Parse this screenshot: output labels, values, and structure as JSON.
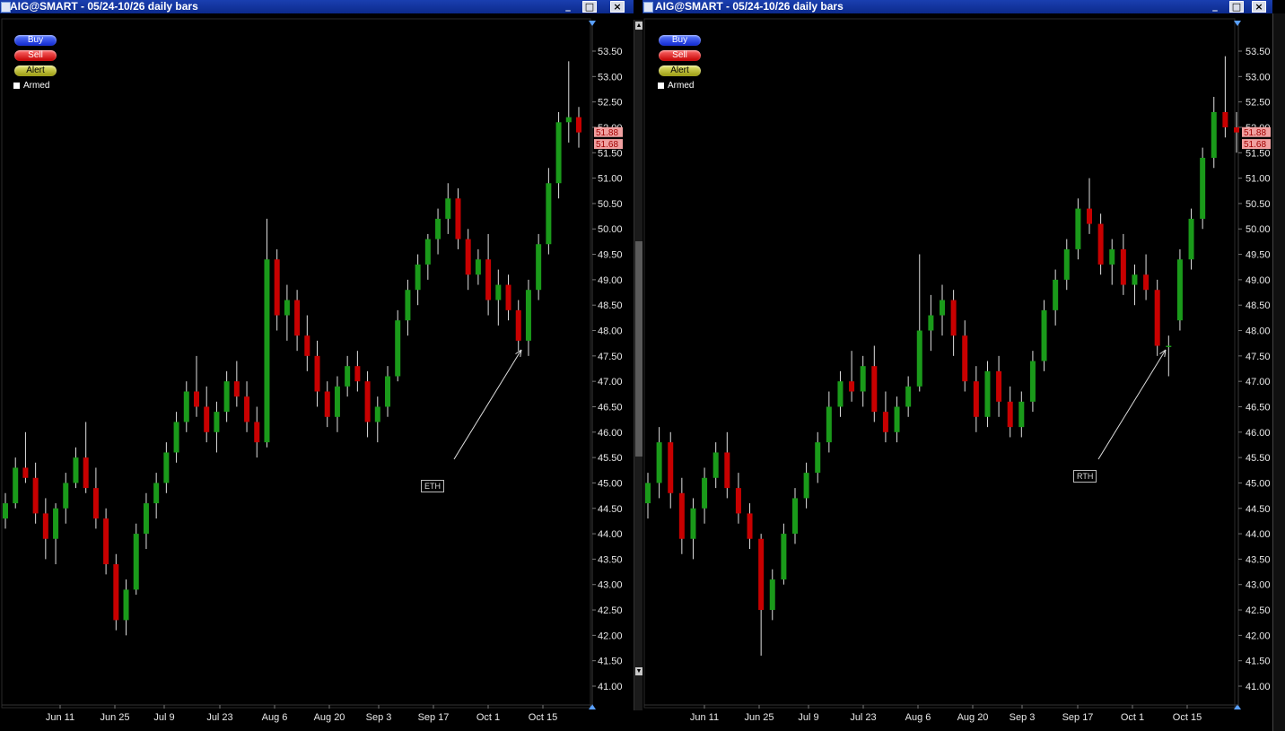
{
  "app": {
    "colors": {
      "bg": "#000000",
      "up": "#1a9a1a",
      "down": "#c80000",
      "wick": "#e0e0e0",
      "title_bar": "#1a3fb0"
    }
  },
  "windows": [
    {
      "title": "AIG@SMART - 05/24-10/26 daily bars",
      "buttons": {
        "buy": "Buy",
        "sell": "Sell",
        "alert": "Alert",
        "armed": "Armed"
      },
      "annotation": "ETH",
      "last_prices": [
        "51.88",
        "51.68"
      ]
    },
    {
      "title": "AIG@SMART - 05/24-10/26 daily bars",
      "buttons": {
        "buy": "Buy",
        "sell": "Sell",
        "alert": "Alert",
        "armed": "Armed"
      },
      "annotation": "RTH",
      "last_prices": [
        "51.88",
        "51.68"
      ]
    }
  ],
  "window_controls": {
    "minimize": "_",
    "maximize": "□",
    "close": "×"
  },
  "chart_data": [
    {
      "type": "candlestick",
      "title": "AIG@SMART - 05/24-10/26 daily bars",
      "session": "ETH",
      "ylim": [
        41.0,
        53.5
      ],
      "yticks": [
        "53.50",
        "53.00",
        "52.50",
        "52.00",
        "51.50",
        "51.00",
        "50.50",
        "50.00",
        "49.50",
        "49.00",
        "48.50",
        "48.00",
        "47.50",
        "47.00",
        "46.50",
        "46.00",
        "45.50",
        "45.00",
        "44.50",
        "44.00",
        "43.50",
        "43.00",
        "42.50",
        "42.00",
        "41.50",
        "41.00"
      ],
      "xticks": [
        "Jun 11",
        "Jun 25",
        "Jul 9",
        "Jul 23",
        "Aug 6",
        "Aug 20",
        "Sep 3",
        "Sep 17",
        "Oct 1",
        "Oct 15"
      ],
      "last": [
        51.88,
        51.68
      ],
      "candles": [
        [
          44.3,
          44.8,
          44.1,
          44.6
        ],
        [
          44.6,
          45.5,
          44.5,
          45.3
        ],
        [
          45.3,
          46.0,
          45.0,
          45.1
        ],
        [
          45.1,
          45.4,
          44.2,
          44.4
        ],
        [
          44.4,
          44.7,
          43.5,
          43.9
        ],
        [
          43.9,
          44.6,
          43.4,
          44.5
        ],
        [
          44.5,
          45.2,
          44.2,
          45.0
        ],
        [
          45.0,
          45.7,
          44.9,
          45.5
        ],
        [
          45.5,
          46.2,
          44.8,
          44.9
        ],
        [
          44.9,
          45.3,
          44.1,
          44.3
        ],
        [
          44.3,
          44.5,
          43.2,
          43.4
        ],
        [
          43.4,
          43.6,
          42.1,
          42.3
        ],
        [
          42.3,
          43.1,
          42.0,
          42.9
        ],
        [
          42.9,
          44.2,
          42.8,
          44.0
        ],
        [
          44.0,
          44.8,
          43.7,
          44.6
        ],
        [
          44.6,
          45.2,
          44.3,
          45.0
        ],
        [
          45.0,
          45.8,
          44.8,
          45.6
        ],
        [
          45.6,
          46.4,
          45.4,
          46.2
        ],
        [
          46.2,
          47.0,
          46.0,
          46.8
        ],
        [
          46.8,
          47.5,
          46.3,
          46.5
        ],
        [
          46.5,
          46.9,
          45.8,
          46.0
        ],
        [
          46.0,
          46.6,
          45.6,
          46.4
        ],
        [
          46.4,
          47.2,
          46.2,
          47.0
        ],
        [
          47.0,
          47.4,
          46.5,
          46.7
        ],
        [
          46.7,
          47.0,
          46.0,
          46.2
        ],
        [
          46.2,
          46.5,
          45.5,
          45.8
        ],
        [
          45.8,
          50.2,
          45.7,
          49.4
        ],
        [
          49.4,
          49.6,
          48.0,
          48.3
        ],
        [
          48.3,
          48.9,
          47.8,
          48.6
        ],
        [
          48.6,
          48.8,
          47.6,
          47.9
        ],
        [
          47.9,
          48.3,
          47.2,
          47.5
        ],
        [
          47.5,
          47.8,
          46.5,
          46.8
        ],
        [
          46.8,
          47.0,
          46.1,
          46.3
        ],
        [
          46.3,
          47.1,
          46.0,
          46.9
        ],
        [
          46.9,
          47.5,
          46.7,
          47.3
        ],
        [
          47.3,
          47.6,
          46.8,
          47.0
        ],
        [
          47.0,
          47.2,
          45.9,
          46.2
        ],
        [
          46.2,
          46.7,
          45.8,
          46.5
        ],
        [
          46.5,
          47.3,
          46.3,
          47.1
        ],
        [
          47.1,
          48.4,
          47.0,
          48.2
        ],
        [
          48.2,
          49.0,
          47.9,
          48.8
        ],
        [
          48.8,
          49.5,
          48.5,
          49.3
        ],
        [
          49.3,
          49.9,
          49.0,
          49.8
        ],
        [
          49.8,
          50.4,
          49.5,
          50.2
        ],
        [
          50.2,
          50.9,
          49.9,
          50.6
        ],
        [
          50.6,
          50.8,
          49.6,
          49.8
        ],
        [
          49.8,
          50.0,
          48.8,
          49.1
        ],
        [
          49.1,
          49.6,
          48.9,
          49.4
        ],
        [
          49.4,
          49.9,
          48.3,
          48.6
        ],
        [
          48.6,
          49.2,
          48.1,
          48.9
        ],
        [
          48.9,
          49.1,
          48.2,
          48.4
        ],
        [
          48.4,
          48.6,
          47.6,
          47.8
        ],
        [
          47.8,
          49.0,
          47.5,
          48.8
        ],
        [
          48.8,
          49.9,
          48.6,
          49.7
        ],
        [
          49.7,
          51.2,
          49.5,
          50.9
        ],
        [
          50.9,
          52.3,
          50.6,
          52.1
        ],
        [
          52.1,
          53.3,
          51.7,
          52.2
        ],
        [
          52.2,
          52.4,
          51.6,
          51.9
        ]
      ]
    },
    {
      "type": "candlestick",
      "title": "AIG@SMART - 05/24-10/26 daily bars",
      "session": "RTH",
      "ylim": [
        41.0,
        53.5
      ],
      "yticks": [
        "53.50",
        "53.00",
        "52.50",
        "52.00",
        "51.50",
        "51.00",
        "50.50",
        "50.00",
        "49.50",
        "49.00",
        "48.50",
        "48.00",
        "47.50",
        "47.00",
        "46.50",
        "46.00",
        "45.50",
        "45.00",
        "44.50",
        "44.00",
        "43.50",
        "43.00",
        "42.50",
        "42.00",
        "41.50",
        "41.00"
      ],
      "xticks": [
        "Jun 11",
        "Jun 25",
        "Jul 9",
        "Jul 23",
        "Aug 6",
        "Aug 20",
        "Sep 3",
        "Sep 17",
        "Oct 1",
        "Oct 15"
      ],
      "last": [
        51.88,
        51.68
      ],
      "candles": [
        [
          44.6,
          45.2,
          44.3,
          45.0
        ],
        [
          45.0,
          46.1,
          44.7,
          45.8
        ],
        [
          45.8,
          46.0,
          44.5,
          44.8
        ],
        [
          44.8,
          45.1,
          43.6,
          43.9
        ],
        [
          43.9,
          44.7,
          43.5,
          44.5
        ],
        [
          44.5,
          45.3,
          44.2,
          45.1
        ],
        [
          45.1,
          45.8,
          44.9,
          45.6
        ],
        [
          45.6,
          46.0,
          44.7,
          44.9
        ],
        [
          44.9,
          45.2,
          44.2,
          44.4
        ],
        [
          44.4,
          44.6,
          43.7,
          43.9
        ],
        [
          43.9,
          44.0,
          41.6,
          42.5
        ],
        [
          42.5,
          43.3,
          42.3,
          43.1
        ],
        [
          43.1,
          44.2,
          43.0,
          44.0
        ],
        [
          44.0,
          44.9,
          43.8,
          44.7
        ],
        [
          44.7,
          45.4,
          44.5,
          45.2
        ],
        [
          45.2,
          46.0,
          45.0,
          45.8
        ],
        [
          45.8,
          46.8,
          45.6,
          46.5
        ],
        [
          46.5,
          47.2,
          46.3,
          47.0
        ],
        [
          47.0,
          47.6,
          46.6,
          46.8
        ],
        [
          46.8,
          47.5,
          46.5,
          47.3
        ],
        [
          47.3,
          47.7,
          46.2,
          46.4
        ],
        [
          46.4,
          46.8,
          45.8,
          46.0
        ],
        [
          46.0,
          46.7,
          45.8,
          46.5
        ],
        [
          46.5,
          47.1,
          46.3,
          46.9
        ],
        [
          46.9,
          49.5,
          46.8,
          48.0
        ],
        [
          48.0,
          48.7,
          47.6,
          48.3
        ],
        [
          48.3,
          48.9,
          47.9,
          48.6
        ],
        [
          48.6,
          48.8,
          47.5,
          47.9
        ],
        [
          47.9,
          48.2,
          46.8,
          47.0
        ],
        [
          47.0,
          47.3,
          46.0,
          46.3
        ],
        [
          46.3,
          47.4,
          46.1,
          47.2
        ],
        [
          47.2,
          47.5,
          46.3,
          46.6
        ],
        [
          46.6,
          46.9,
          45.9,
          46.1
        ],
        [
          46.1,
          46.8,
          45.9,
          46.6
        ],
        [
          46.6,
          47.6,
          46.4,
          47.4
        ],
        [
          47.4,
          48.6,
          47.2,
          48.4
        ],
        [
          48.4,
          49.2,
          48.1,
          49.0
        ],
        [
          49.0,
          49.8,
          48.8,
          49.6
        ],
        [
          49.6,
          50.6,
          49.4,
          50.4
        ],
        [
          50.4,
          51.0,
          49.9,
          50.1
        ],
        [
          50.1,
          50.3,
          49.1,
          49.3
        ],
        [
          49.3,
          49.8,
          48.9,
          49.6
        ],
        [
          49.6,
          49.9,
          48.7,
          48.9
        ],
        [
          48.9,
          49.3,
          48.5,
          49.1
        ],
        [
          49.1,
          49.5,
          48.6,
          48.8
        ],
        [
          48.8,
          49.0,
          47.5,
          47.7
        ],
        [
          47.7,
          47.9,
          47.1,
          47.7
        ],
        [
          48.2,
          49.6,
          48.0,
          49.4
        ],
        [
          49.4,
          50.4,
          49.2,
          50.2
        ],
        [
          50.2,
          51.6,
          50.0,
          51.4
        ],
        [
          51.4,
          52.6,
          51.2,
          52.3
        ],
        [
          52.3,
          53.4,
          51.8,
          52.0
        ],
        [
          52.0,
          52.3,
          51.5,
          51.9
        ]
      ]
    }
  ]
}
